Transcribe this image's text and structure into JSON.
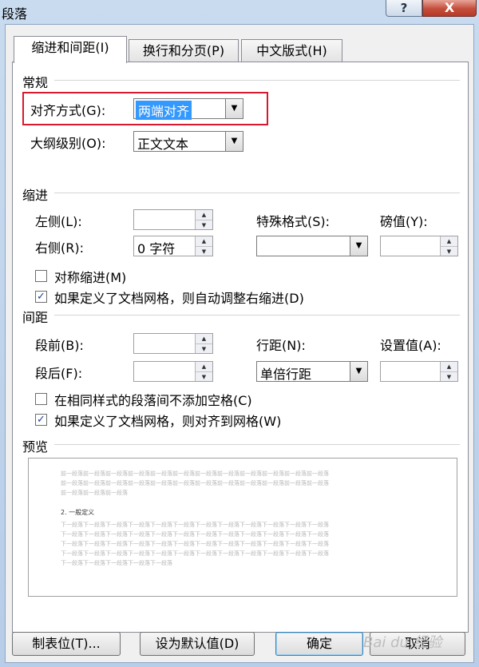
{
  "window": {
    "title": "段落",
    "help_label": "?",
    "close_label": "X"
  },
  "tabs": [
    {
      "label": "缩进和间距(I)"
    },
    {
      "label": "换行和分页(P)"
    },
    {
      "label": "中文版式(H)"
    }
  ],
  "general": {
    "title": "常规",
    "alignment_label": "对齐方式(G):",
    "alignment_value": "两端对齐",
    "outline_label": "大纲级别(O):",
    "outline_value": "正文文本"
  },
  "indent": {
    "title": "缩进",
    "left_label": "左侧(L):",
    "left_value": "",
    "right_label": "右侧(R):",
    "right_value": "0 字符",
    "special_label": "特殊格式(S):",
    "special_value": "",
    "by_label": "磅值(Y):",
    "by_value": "",
    "mirror_label": "对称缩进(M)",
    "mirror_checked": false,
    "auto_adjust_label": "如果定义了文档网格，则自动调整右缩进(D)",
    "auto_adjust_checked": true
  },
  "spacing": {
    "title": "间距",
    "before_label": "段前(B):",
    "before_value": "",
    "after_label": "段后(F):",
    "after_value": "",
    "line_label": "行距(N):",
    "line_value": "单倍行距",
    "at_label": "设置值(A):",
    "at_value": "",
    "no_space_label": "在相同样式的段落间不添加空格(C)",
    "no_space_checked": false,
    "snap_grid_label": "如果定义了文档网格，则对齐到网格(W)",
    "snap_grid_checked": true
  },
  "preview": {
    "title": "预览",
    "prev_para": [
      "前一段落前一段落前一段落前一段落前一段落前一段落前一段落前一段落前一段落前一段落前一段落前一段落",
      "前一段落前一段落前一段落前一段落前一段落前一段落前一段落前一段落前一段落前一段落前一段落前一段落",
      "前一段落前一段落前一段落"
    ],
    "main_text": "2.  一般定义",
    "next_para": [
      "下一段落下一段落下一段落下一段落下一段落下一段落下一段落下一段落下一段落下一段落下一段落下一段落",
      "下一段落下一段落下一段落下一段落下一段落下一段落下一段落下一段落下一段落下一段落下一段落下一段落",
      "下一段落下一段落下一段落下一段落下一段落下一段落下一段落下一段落下一段落下一段落下一段落下一段落",
      "下一段落下一段落下一段落下一段落下一段落下一段落下一段落下一段落下一段落下一段落下一段落下一段落",
      "下一段落下一段落下一段落下一段落下一段落"
    ]
  },
  "buttons": {
    "tabs_label": "制表位(T)...",
    "default_label": "设为默认值(D)",
    "ok_label": "确定",
    "cancel_label": "取消"
  },
  "watermark": "Bai du 经验"
}
